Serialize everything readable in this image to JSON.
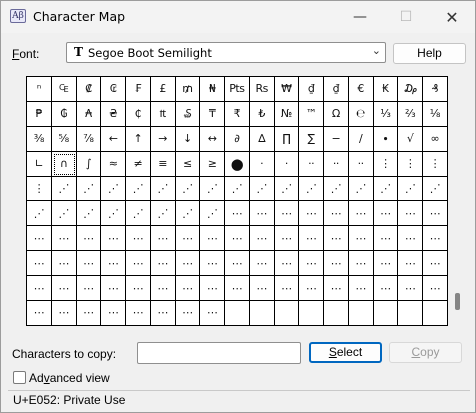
{
  "window": {
    "title": "Character Map",
    "icon_glyph": "Aβ",
    "min_glyph": "—",
    "max_glyph": "☐",
    "close_glyph": "✕"
  },
  "font": {
    "label_hotkey": "F",
    "label_rest": "ont:",
    "tt_glyph": "T",
    "value": "Segoe Boot Semilight",
    "chevron": "⌄"
  },
  "help_button": {
    "label": "Help"
  },
  "grid": {
    "selected_index": 52,
    "cells": [
      "ⁿ",
      "₠",
      "₡",
      "₢",
      "₣",
      "£",
      "₥",
      "₦",
      "Pts",
      "Rs",
      "₩",
      "₫",
      "₫",
      "€",
      "₭",
      "₯",
      "₰",
      "₱",
      "₲",
      "₳",
      "₴",
      "₵",
      "₶",
      "₷",
      "₸",
      "₹",
      "₺",
      "№",
      "™",
      "Ω",
      "℮",
      "⅓",
      "⅔",
      "⅛",
      "⅜",
      "⅝",
      "⅞",
      "←",
      "↑",
      "→",
      "↓",
      "↔",
      "∂",
      "∆",
      "∏",
      "∑",
      "−",
      "∕",
      "∙",
      "√",
      "∞",
      "∟",
      "∩",
      "∫",
      "≈",
      "≠",
      "≡",
      "≤",
      "≥",
      "●",
      "·",
      "·",
      "··",
      "··",
      "··",
      "⋮",
      "⋮",
      "⋮",
      "⋮",
      "⋰",
      "⋰",
      "⋰",
      "⋰",
      "⋰",
      "⋰",
      "⋰",
      "⋰",
      "⋰",
      "⋰",
      "⋰",
      "⋰",
      "⋰",
      "⋰",
      "⋰",
      "⋰",
      "⋰",
      "⋰",
      "⋰",
      "⋰",
      "⋰",
      "⋰",
      "⋰",
      "⋰",
      "⋯",
      "⋯",
      "⋯",
      "⋯",
      "⋯",
      "⋯",
      "⋯",
      "⋯",
      "⋯",
      "⋯",
      "⋯",
      "⋯",
      "⋯",
      "⋯",
      "⋯",
      "⋯",
      "⋯",
      "⋯",
      "⋯",
      "⋯",
      "⋯",
      "⋯",
      "⋯",
      "⋯",
      "⋯",
      "⋯",
      "⋯",
      "⋯",
      "⋯",
      "⋯",
      "⋯",
      "⋯",
      "⋯",
      "⋯",
      "⋯",
      "⋯",
      "⋯",
      "⋯",
      "⋯",
      "⋯",
      "⋯",
      "⋯",
      "⋯",
      "⋯",
      "⋯",
      "⋯",
      "⋯",
      "⋯",
      "⋯",
      "⋯",
      "⋯",
      "⋯",
      "⋯",
      "⋯",
      "⋯",
      "⋯",
      "⋯",
      "⋯",
      "⋯",
      "⋯",
      "⋯",
      "⋯",
      "⋯",
      "⋯",
      "⋯",
      "⋯",
      "⋯",
      "⋯",
      "",
      "",
      "",
      "",
      "",
      "",
      "",
      "",
      "",
      "",
      "",
      "",
      "",
      "",
      "",
      "",
      ""
    ]
  },
  "copy": {
    "label": "Characters to copy:",
    "value": "",
    "select_hotkey": "S",
    "select_rest": "elect",
    "copy_hotkey": "C",
    "copy_rest": "opy"
  },
  "advanced": {
    "label_pre": "Ad",
    "label_hotkey": "v",
    "label_rest": "anced view",
    "checked": false
  },
  "status": {
    "text": "U+E052: Private Use"
  }
}
